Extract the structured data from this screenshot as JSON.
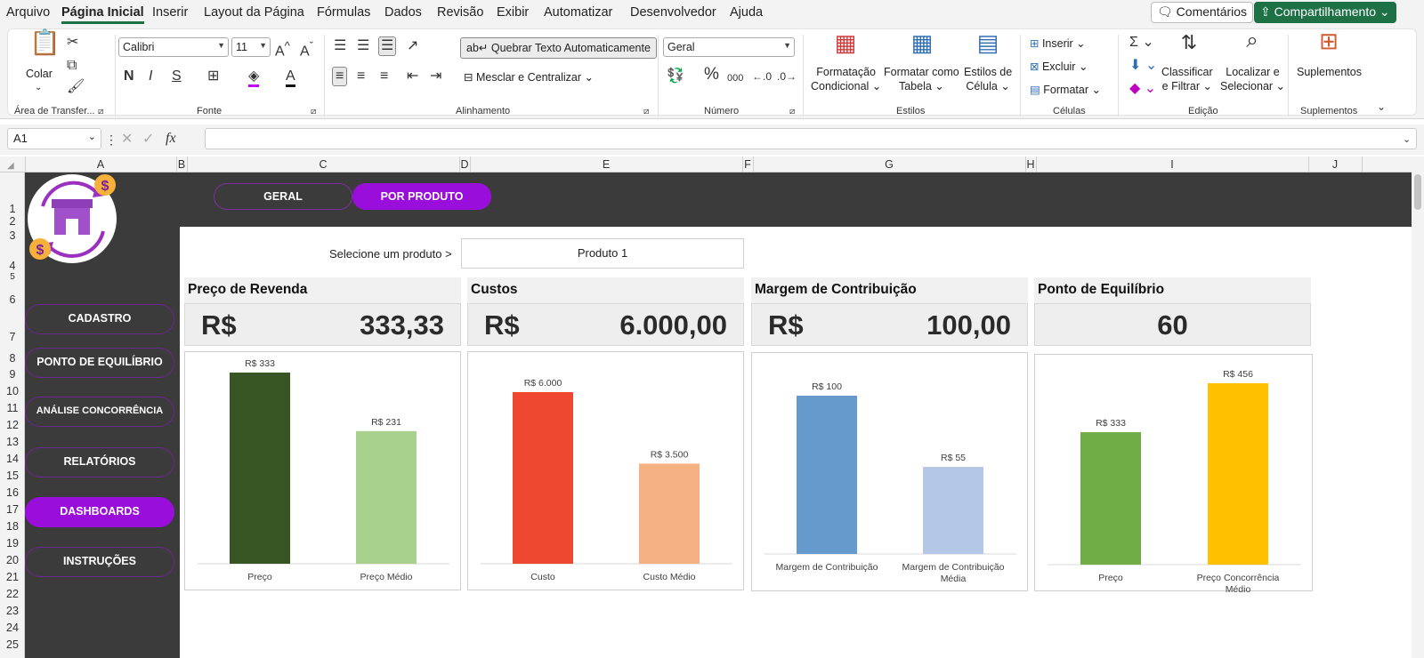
{
  "menu": {
    "items": [
      "Arquivo",
      "Página Inicial",
      "Inserir",
      "Layout da Página",
      "Fórmulas",
      "Dados",
      "Revisão",
      "Exibir",
      "Automatizar",
      "Desenvolvedor",
      "Ajuda"
    ],
    "comments": "Comentários",
    "share": "Compartilhamento"
  },
  "ribbon": {
    "clipboard": {
      "paste": "Colar",
      "label": "Área de Transfer..."
    },
    "font": {
      "name": "Calibri",
      "size": "11",
      "label": "Fonte",
      "bold": "N",
      "italic": "I",
      "underline": "S"
    },
    "alignment": {
      "wrap": "Quebrar Texto Automaticamente",
      "merge": "Mesclar e Centralizar",
      "label": "Alinhamento"
    },
    "number": {
      "format": "Geral",
      "label": "Número",
      "percent": "%",
      "thousands": "000"
    },
    "styles": {
      "conditional_1": "Formatação",
      "conditional_2": "Condicional",
      "table_1": "Formatar como",
      "table_2": "Tabela",
      "cell_1": "Estilos de",
      "cell_2": "Célula",
      "label": "Estilos"
    },
    "cells": {
      "insert": "Inserir",
      "delete": "Excluir",
      "format": "Formatar",
      "label": "Células"
    },
    "editing": {
      "sort_1": "Classificar",
      "sort_2": "e Filtrar",
      "find_1": "Localizar e",
      "find_2": "Selecionar",
      "label": "Edição"
    },
    "addins": {
      "button": "Suplementos",
      "label": "Suplementos"
    }
  },
  "formula_bar": {
    "name_box": "A1",
    "fx": "fx",
    "formula": ""
  },
  "columns": [
    "A",
    "B",
    "C",
    "D",
    "E",
    "F",
    "G",
    "H",
    "I",
    "J"
  ],
  "rows": [
    "1",
    "2",
    "3",
    "4",
    "5",
    "6",
    "7",
    "8",
    "9",
    "10",
    "11",
    "12",
    "13",
    "14",
    "15",
    "16",
    "17",
    "18",
    "19",
    "20",
    "21",
    "22",
    "23",
    "24",
    "25"
  ],
  "dashboard": {
    "tabs": [
      "GERAL",
      "POR PRODUTO"
    ],
    "nav": [
      "CADASTRO",
      "PONTO DE EQUILÍBRIO",
      "ANÁLISE CONCORRÊNCIA",
      "RELATÓRIOS",
      "DASHBOARDS",
      "INSTRUÇÕES"
    ],
    "selector_label": "Selecione um produto >",
    "selector_value": "Produto 1",
    "kpis": [
      {
        "title": "Preço de Revenda",
        "currency": "R$",
        "value": "333,33"
      },
      {
        "title": "Custos",
        "currency": "R$",
        "value": "6.000,00"
      },
      {
        "title": "Margem de Contribuição",
        "currency": "R$",
        "value": "100,00"
      },
      {
        "title": "Ponto de Equilíbrio",
        "currency": "",
        "value": "60"
      }
    ],
    "logo_symbol": "$"
  },
  "chart_data": [
    {
      "type": "bar",
      "categories": [
        "Preço",
        "Preço Médio"
      ],
      "values": [
        333,
        231
      ],
      "labels": [
        "R$ 333",
        "R$ 231"
      ],
      "colors": [
        "#375623",
        "#a9d18e"
      ]
    },
    {
      "type": "bar",
      "categories": [
        "Custo",
        "Custo Médio"
      ],
      "values": [
        6000,
        3500
      ],
      "labels": [
        "R$ 6.000",
        "R$ 3.500"
      ],
      "colors": [
        "#ee4831",
        "#f4b183"
      ]
    },
    {
      "type": "bar",
      "categories": [
        "Margem de Contribuição",
        "Margem de Contribuição Média"
      ],
      "values": [
        100,
        55
      ],
      "labels": [
        "R$ 100",
        "R$ 55"
      ],
      "colors": [
        "#6699cc",
        "#b4c7e7"
      ]
    },
    {
      "type": "bar",
      "categories": [
        "Preço",
        "Preço Concorrência Médio"
      ],
      "values": [
        333,
        456
      ],
      "labels": [
        "R$ 333",
        "R$ 456"
      ],
      "colors": [
        "#70ad47",
        "#ffc000"
      ]
    }
  ]
}
